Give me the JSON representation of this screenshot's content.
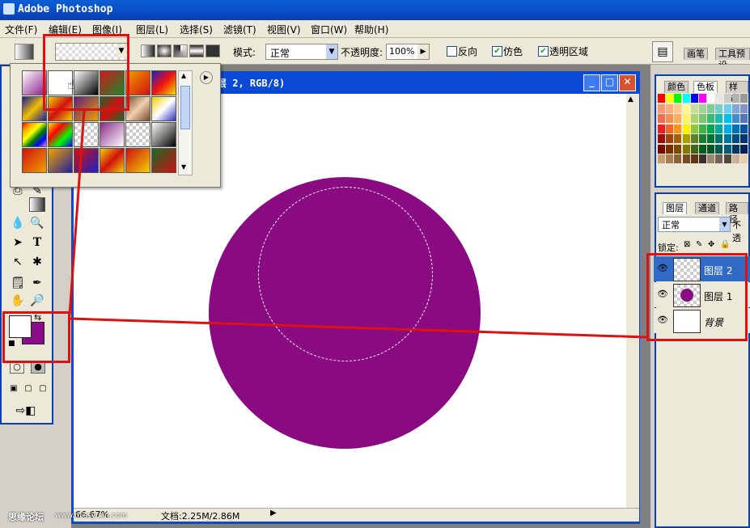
{
  "app": {
    "title": "Adobe Photoshop"
  },
  "menu": [
    "文件(F)",
    "编辑(E)",
    "图像(I)",
    "图层(L)",
    "选择(S)",
    "滤镜(T)",
    "视图(V)",
    "窗口(W)",
    "帮助(H)"
  ],
  "options": {
    "mode_label": "模式:",
    "mode_value": "正常",
    "opacity_label": "不透明度:",
    "opacity_value": "100%",
    "reverse_label": "反向",
    "dither_label": "仿色",
    "transparency_label": "透明区域",
    "reverse_checked": false,
    "dither_checked": true,
    "transparency_checked": true,
    "panel_tabs": [
      "画笔",
      "工具预设"
    ]
  },
  "document": {
    "title_fragment": "层 2, RGB/8)"
  },
  "status": {
    "zoom": "66.67%",
    "doc_info": "文档:2.25M/2.86M"
  },
  "panels": {
    "color_tabs": [
      "颜色",
      "色板",
      "样式"
    ],
    "layers_tabs": [
      "图层",
      "通道",
      "路径"
    ],
    "blend_mode": "正常",
    "opacity_label": "不透",
    "lock_label": "锁定:",
    "layers": [
      {
        "name": "图层 2",
        "selected": true
      },
      {
        "name": "图层 1",
        "selected": false
      },
      {
        "name": "背景",
        "selected": false
      }
    ]
  },
  "colors": {
    "foreground": "#ffffff",
    "background": "#8b0c8b",
    "sphere": "#8a0a82",
    "accent": "#e01010"
  },
  "watermark": {
    "left": "思缘论坛",
    "right": "www.missyuan.com"
  }
}
